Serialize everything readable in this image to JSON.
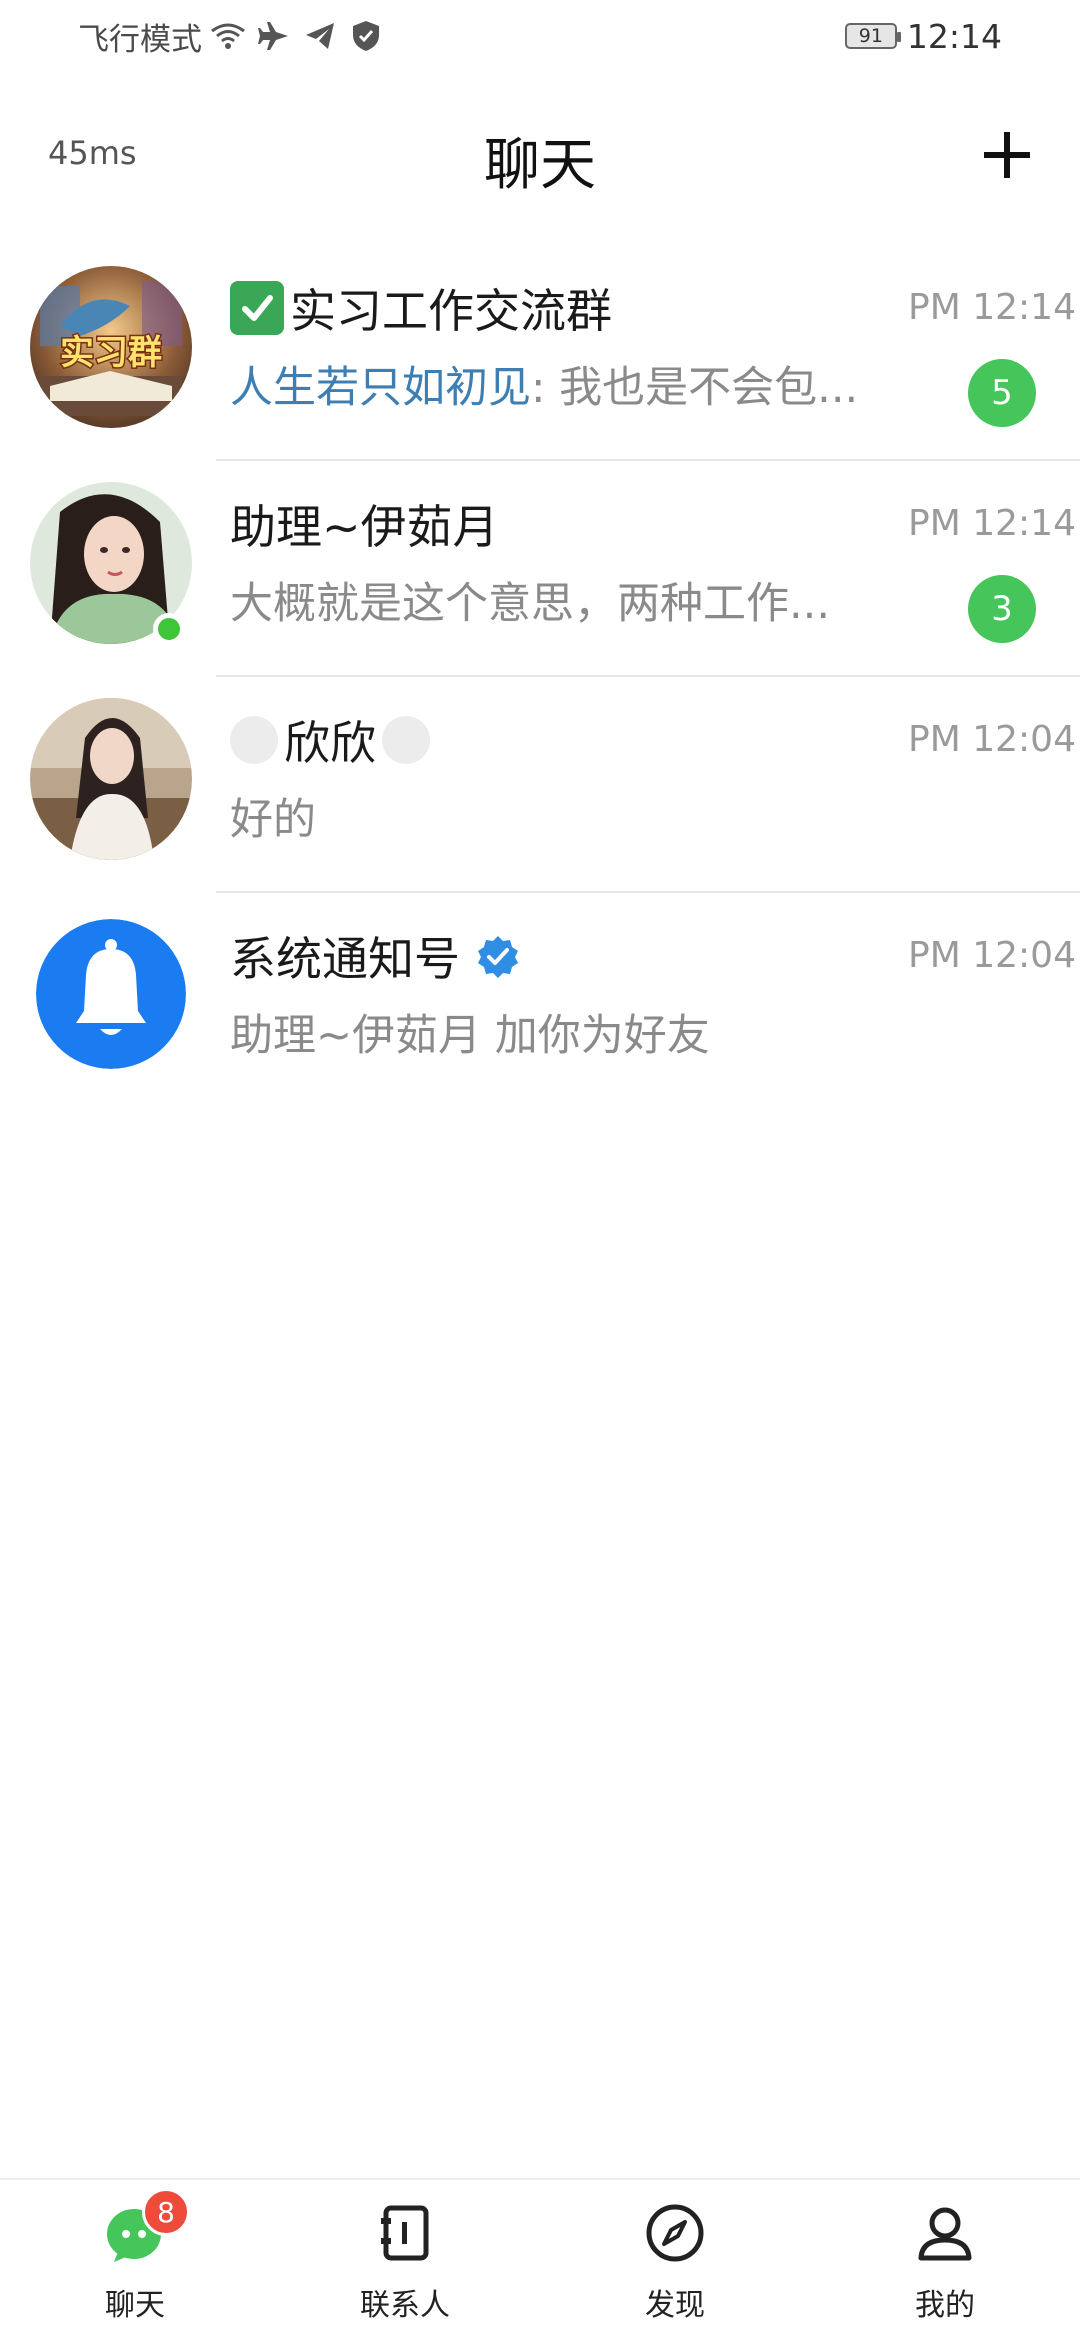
{
  "status_bar": {
    "mode_text": "飞行模式",
    "battery_level": "91",
    "time": "12:14"
  },
  "header": {
    "latency": "45ms",
    "title": "聊天",
    "add_icon": "plus-icon"
  },
  "chats": [
    {
      "name": "实习工作交流群",
      "name_prefix_icon": "check-box-icon",
      "time": "PM 12:14",
      "sender": "人生若只如初见",
      "message": ": 我也是不会包...",
      "unread": "5",
      "avatar_text": "实习群"
    },
    {
      "name": "助理~伊茹月",
      "time": "PM 12:14",
      "message": "大概就是这个意思，两种工作...",
      "unread": "3",
      "online": true
    },
    {
      "name": "欣欣",
      "time": "PM 12:04",
      "message": "好的"
    },
    {
      "name": "系统通知号",
      "verified_icon": "verified-badge-icon",
      "time": "PM 12:04",
      "message": "助理~伊茹月 加你为好友"
    }
  ],
  "bottom_nav": [
    {
      "label": "聊天",
      "icon": "chat-bubble-icon",
      "badge": "8"
    },
    {
      "label": "联系人",
      "icon": "contacts-book-icon"
    },
    {
      "label": "发现",
      "icon": "compass-icon"
    },
    {
      "label": "我的",
      "icon": "person-icon"
    }
  ],
  "colors": {
    "accent_green": "#45c55a",
    "sender_blue": "#3e7fb3",
    "badge_red": "#ee4b3b",
    "notify_blue": "#1a7cf0"
  }
}
